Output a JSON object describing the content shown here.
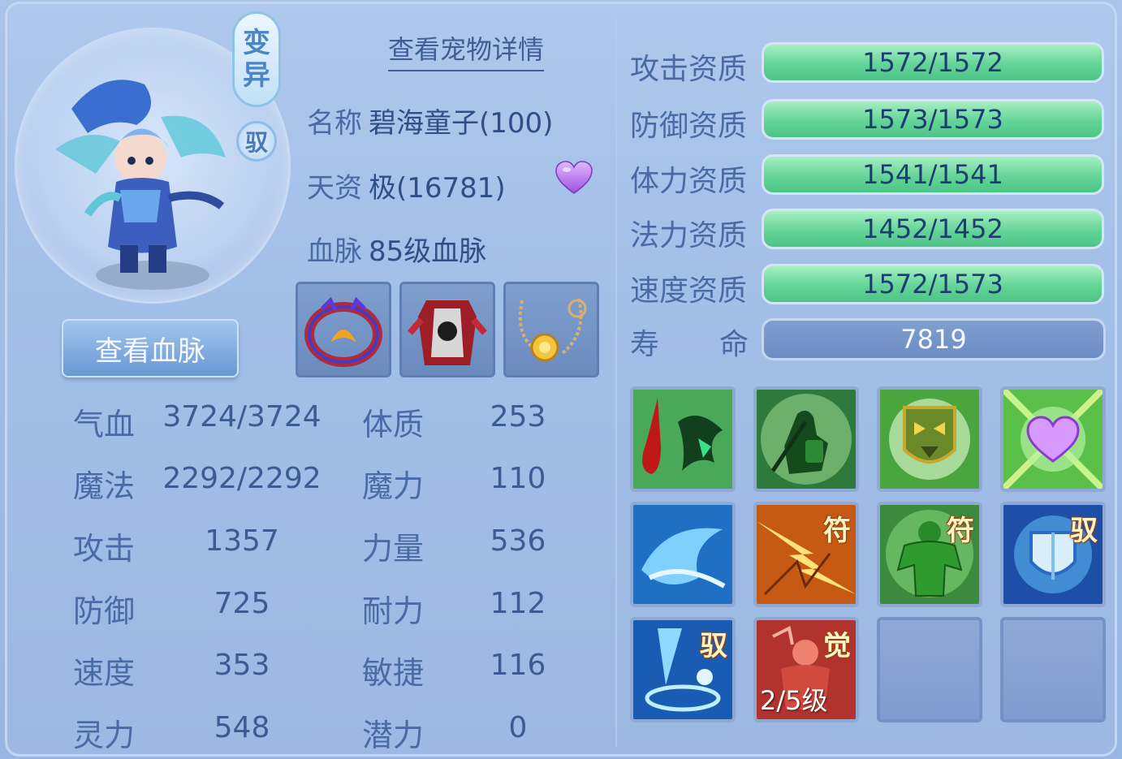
{
  "pet": {
    "mutate_badge": [
      "变",
      "异"
    ],
    "ride_badge": "驭",
    "view_detail": "查看宠物详情",
    "view_bloodline": "查看血脉",
    "info": [
      {
        "label": "名称",
        "value": "碧海童子(100)"
      },
      {
        "label": "天资",
        "value": "极(16781)"
      },
      {
        "label": "血脉",
        "value": "85级血脉"
      }
    ]
  },
  "stats_left": [
    {
      "label": "气血",
      "value": "3724/3724"
    },
    {
      "label": "魔法",
      "value": "2292/2292"
    },
    {
      "label": "攻击",
      "value": "1357"
    },
    {
      "label": "防御",
      "value": "725"
    },
    {
      "label": "速度",
      "value": "353"
    },
    {
      "label": "灵力",
      "value": "548"
    }
  ],
  "stats_right": [
    {
      "label": "体质",
      "value": "253"
    },
    {
      "label": "魔力",
      "value": "110"
    },
    {
      "label": "力量",
      "value": "536"
    },
    {
      "label": "耐力",
      "value": "112"
    },
    {
      "label": "敏捷",
      "value": "116"
    },
    {
      "label": "潜力",
      "value": "0"
    }
  ],
  "aptitudes": [
    {
      "label": "攻击资质",
      "value": "1572/1572"
    },
    {
      "label": "防御资质",
      "value": "1573/1573"
    },
    {
      "label": "体力资质",
      "value": "1541/1541"
    },
    {
      "label": "法力资质",
      "value": "1452/1452"
    },
    {
      "label": "速度资质",
      "value": "1572/1573"
    }
  ],
  "life": {
    "label_a": "寿",
    "label_b": "命",
    "value": "7819"
  },
  "equipment": [
    "ring-icon",
    "armor-icon",
    "necklace-icon"
  ],
  "skills": [
    {
      "icon": "blood-claw-icon",
      "tag": "",
      "level": ""
    },
    {
      "icon": "shadow-warrior-icon",
      "tag": "",
      "level": ""
    },
    {
      "icon": "green-shield-icon",
      "tag": "",
      "level": ""
    },
    {
      "icon": "heart-star-icon",
      "tag": "",
      "level": ""
    },
    {
      "icon": "water-wave-icon",
      "tag": "",
      "level": ""
    },
    {
      "icon": "lightning-burst-icon",
      "tag": "符",
      "level": ""
    },
    {
      "icon": "muscle-giant-icon",
      "tag": "符",
      "level": ""
    },
    {
      "icon": "guard-shield-icon",
      "tag": "驭",
      "level": ""
    },
    {
      "icon": "water-slash-icon",
      "tag": "驭",
      "level": ""
    },
    {
      "icon": "awaken-warrior-icon",
      "tag": "觉",
      "level": "2/5级"
    },
    {
      "icon": "empty-slot",
      "tag": "",
      "level": ""
    },
    {
      "icon": "empty-slot",
      "tag": "",
      "level": ""
    }
  ],
  "colors": {
    "accent": "#4a6aa6",
    "bar_green": "#63d498",
    "life_bar": "#6d8cc3"
  }
}
